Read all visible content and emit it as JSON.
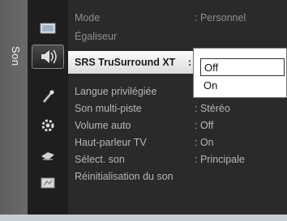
{
  "sidebar": {
    "label": "Son",
    "icons": [
      {
        "name": "picture-icon"
      },
      {
        "name": "sound-icon"
      },
      {
        "name": "channel-icon"
      },
      {
        "name": "setup-icon"
      },
      {
        "name": "input-icon"
      },
      {
        "name": "application-icon"
      }
    ]
  },
  "menu": {
    "items": [
      {
        "label": "Mode",
        "value": ": Personnel"
      },
      {
        "label": "Égaliseur",
        "value": ""
      },
      {
        "label": "SRS TruSurround XT",
        "value": ":"
      },
      {
        "label": "Langue privilégiée",
        "value": ":"
      },
      {
        "label": "Son multi-piste",
        "value": ": Stéréo"
      },
      {
        "label": "Volume auto",
        "value": ": Off"
      },
      {
        "label": "Haut-parleur TV",
        "value": ": On"
      },
      {
        "label": "Sélect. son",
        "value": ": Principale"
      },
      {
        "label": "Réinitialisation du son",
        "value": ""
      }
    ]
  },
  "dropdown": {
    "options": [
      {
        "label": "Off"
      },
      {
        "label": "On"
      }
    ],
    "selected": "Off"
  },
  "colors": {
    "panel": "#2a2a2a",
    "highlight": "#f4f4f4",
    "text_dim": "#8f8f8f"
  }
}
